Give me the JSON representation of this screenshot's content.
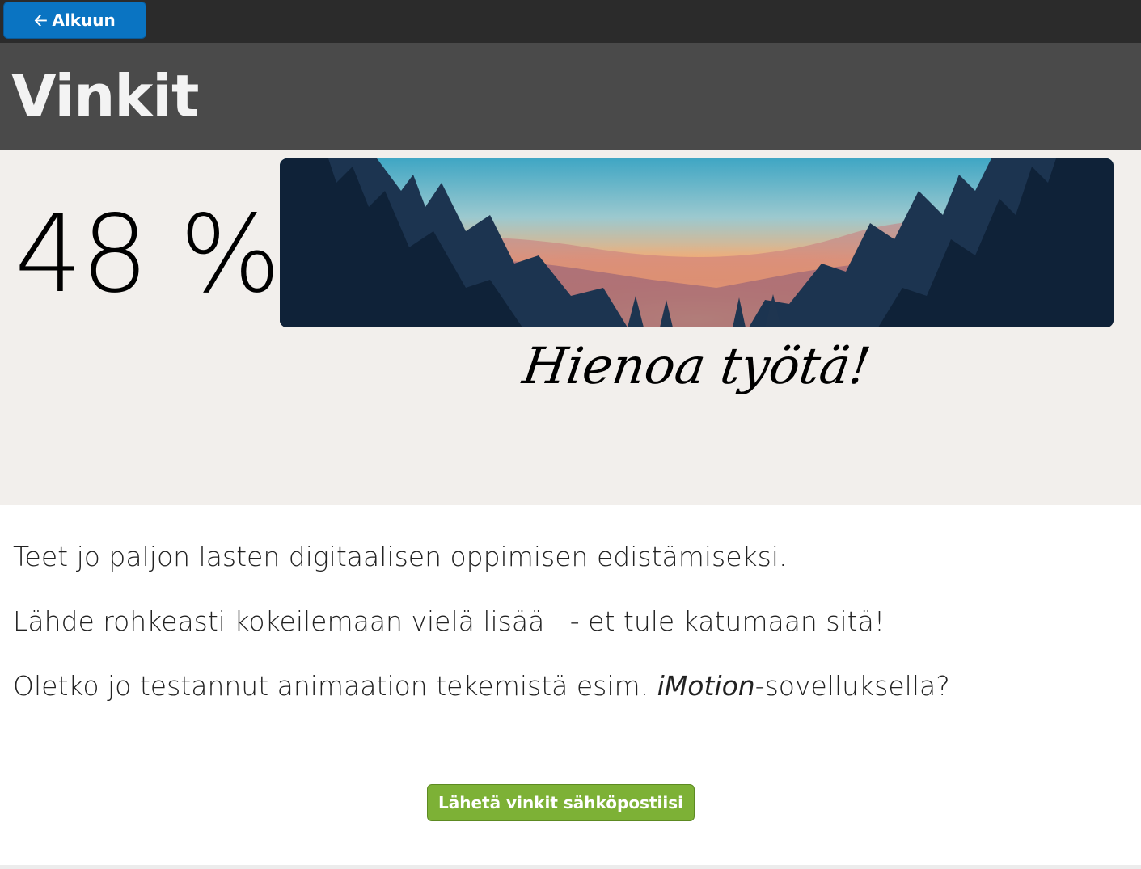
{
  "topbar": {
    "back_label": "Alkuun",
    "back_icon": "arrow-left-icon"
  },
  "header": {
    "title": "Vinkit"
  },
  "result": {
    "percent": "48 %",
    "praise": "Hienoa työtä!",
    "banner_image": "forest-sunset-illustration"
  },
  "content": {
    "paragraph_1": "Teet jo paljon lasten digitaalisen oppimisen edistämiseksi.",
    "paragraph_2": "Lähde rohkeasti kokeilemaan vielä lisää   - et tule katumaan sitä!",
    "paragraph_3_before": "Oletko jo testannut animaation tekemistä esim. ",
    "paragraph_3_italic": "iMotion",
    "paragraph_3_after": "-sovelluksella?"
  },
  "actions": {
    "send_label": "Lähetä vinkit sähköpostiisi"
  },
  "colors": {
    "topbar": "#2b2b2b",
    "title_bar": "#4a4a4a",
    "result_bg": "#f2efec",
    "back_button": "#0a74c2",
    "send_button": "#7db136"
  }
}
